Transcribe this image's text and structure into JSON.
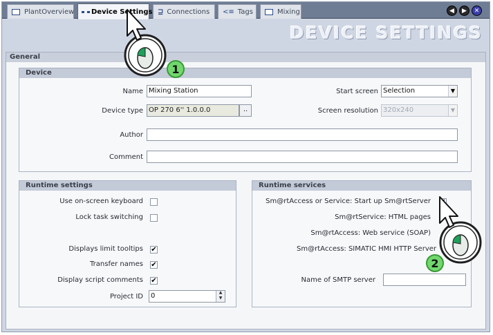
{
  "tabs": [
    {
      "label": "PlantOverview",
      "icon": "screen-icon"
    },
    {
      "label": "Device Settings",
      "icon": "device-settings-icon"
    },
    {
      "label": "Connections",
      "icon": "connections-icon"
    },
    {
      "label": "Tags",
      "icon": "tags-icon"
    },
    {
      "label": "Mixing",
      "icon": "screen-icon"
    }
  ],
  "window_controls": {
    "prev": "◀",
    "next": "▶",
    "close": "✕"
  },
  "banner": {
    "title": "DEVICE SETTINGS"
  },
  "general": {
    "title": "General"
  },
  "device": {
    "title": "Device",
    "name_label": "Name",
    "name_value": "Mixing Station",
    "type_label": "Device type",
    "type_value": "OP 270 6'' 1.0.0.0",
    "type_button": "..",
    "author_label": "Author",
    "author_value": "",
    "comment_label": "Comment",
    "comment_value": "",
    "start_screen_label": "Start screen",
    "start_screen_value": "Selection",
    "resolution_label": "Screen resolution",
    "resolution_value": "320x240"
  },
  "runtime_settings": {
    "title": "Runtime settings",
    "onscreen_keyboard": {
      "label": "Use on-screen keyboard",
      "checked": ""
    },
    "lock_task": {
      "label": "Lock task switching",
      "checked": ""
    },
    "limit_tooltips": {
      "label": "Displays limit tooltips",
      "checked": "✔"
    },
    "transfer_names": {
      "label": "Transfer names",
      "checked": "✔"
    },
    "script_comments": {
      "label": "Display script comments",
      "checked": "✔"
    },
    "project_id": {
      "label": "Project ID",
      "value": "0"
    }
  },
  "runtime_services": {
    "title": "Runtime services",
    "smartaccess": {
      "label": "Sm@rtAccess or Service: Start up Sm@rtServer",
      "checked": "✔"
    },
    "html_pages": {
      "label": "Sm@rtService: HTML pages"
    },
    "web_service": {
      "label": "Sm@rtAccess: Web service (SOAP)"
    },
    "http_server": {
      "label": "Sm@rtAccess: SIMATIC HMI HTTP Server"
    },
    "smtp": {
      "label": "Name of SMTP server",
      "value": ""
    }
  },
  "hints": {
    "step1": "1",
    "step2": "2"
  },
  "colors": {
    "badge": "#71d86e",
    "tabstrip": "#6f7d94"
  }
}
